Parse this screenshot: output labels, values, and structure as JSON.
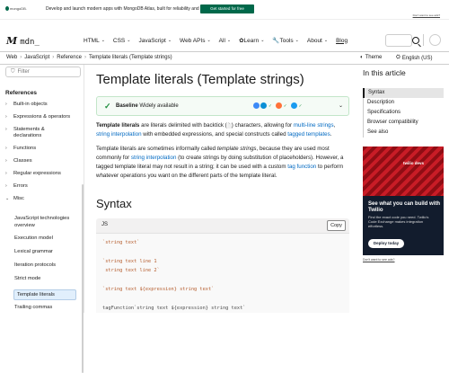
{
  "ad_bar": {
    "brand": "mongoDB.",
    "text": "Develop and launch modern apps with MongoDB Atlas, built for reliability and scale.",
    "cta": "Get started for free",
    "link": "Don't want to see ads?"
  },
  "header": {
    "logo_mark": "M",
    "logo_text": "mdn_",
    "nav": [
      {
        "label": "HTML",
        "chevron": true
      },
      {
        "label": "CSS",
        "chevron": true
      },
      {
        "label": "JavaScript",
        "chevron": true
      },
      {
        "label": "Web APIs",
        "chevron": true
      },
      {
        "label": "All",
        "chevron": true
      },
      {
        "label": "✿Learn",
        "chevron": true
      },
      {
        "label": "🔧Tools",
        "chevron": true
      },
      {
        "label": "About",
        "chevron": true
      },
      {
        "label": "Blog",
        "chevron": false
      }
    ]
  },
  "breadcrumb": {
    "items": [
      "Web",
      "JavaScript",
      "Reference",
      "Template literals (Template strings)"
    ],
    "theme_label": "Theme",
    "lang_label": "English (US)"
  },
  "sidebar": {
    "filter_placeholder": "Filter",
    "heading": "References",
    "items": [
      "Built-in objects",
      "Expressions & operators",
      "Statements & declarations",
      "Functions",
      "Classes",
      "Regular expressions",
      "Errors",
      "Misc"
    ],
    "sub_items": [
      "JavaScript technologies overview",
      "Execution model",
      "Lexical grammar",
      "Iteration protocols",
      "Strict mode",
      "Template literals",
      "Trailing commas"
    ],
    "active_sub": "Template literals"
  },
  "main": {
    "title": "Template literals (Template strings)",
    "baseline_bold": "Baseline",
    "baseline_text": "Widely available",
    "para1_bold": "Template literals",
    "para1_a": " are literals delimited with backtick (",
    "para1_code": "`",
    "para1_b": ") characters, allowing for ",
    "para1_link1": "multi-line strings",
    "para1_c": ", ",
    "para1_link2": "string interpolation",
    "para1_d": " with embedded expressions, and special constructs called ",
    "para1_link3": "tagged templates",
    "para1_e": ".",
    "para2_a": "Template literals are sometimes informally called ",
    "para2_em": "template strings",
    "para2_b": ", because they are used most commonly for ",
    "para2_link1": "string interpolation",
    "para2_c": " (to create strings by doing substitution of placeholders). However, a tagged template literal may not result in a string; it can be used with a custom ",
    "para2_link2": "tag function",
    "para2_d": " to perform whatever operations you want on the different parts of the template literal.",
    "syntax_title": "Syntax",
    "code_lang": "JS",
    "copy_label": "Copy",
    "code_lines": [
      "`string text`",
      "`string text line 1",
      " string text line 2`",
      "`string text ${expression} string text`",
      "tagFunction`string text ${expression} string text`"
    ]
  },
  "toc": {
    "title": "In this article",
    "items": [
      "Syntax",
      "Description",
      "Specifications",
      "Browser compatibility",
      "See also"
    ],
    "active": "Syntax"
  },
  "side_ad": {
    "badge": "twilio devs",
    "heading": "See what you can build with Twilio",
    "body": "Find the exact code you need. Twilio's Code Exchange makes integration effortless.",
    "cta": "Deploy today",
    "link": "Don't want to see ads?"
  },
  "colors": {
    "link": "#0069c2",
    "baseline_green": "#1e8e3e",
    "ad_green": "#00684a",
    "ad_red": "#b5121b"
  }
}
